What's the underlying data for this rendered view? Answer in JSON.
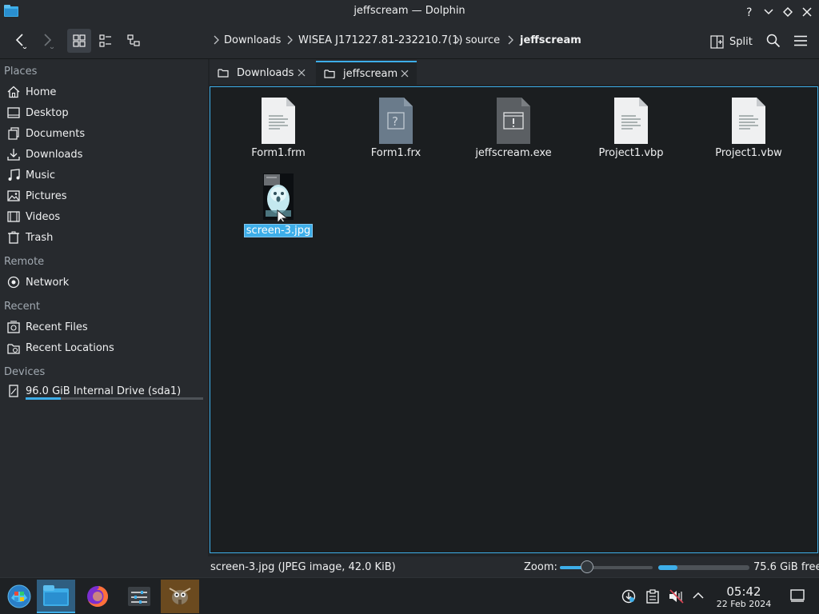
{
  "window": {
    "title": "jeffscream — Dolphin"
  },
  "toolbar": {
    "breadcrumb": [
      "Downloads",
      "WISEA J171227.81-232210.7(1)",
      "source",
      "jeffscream"
    ],
    "split_label": "Split"
  },
  "sidebar": {
    "sections": {
      "places": "Places",
      "remote": "Remote",
      "recent": "Recent",
      "devices": "Devices"
    },
    "places": [
      {
        "label": "Home",
        "icon": "home-icon"
      },
      {
        "label": "Desktop",
        "icon": "desktop-icon"
      },
      {
        "label": "Documents",
        "icon": "documents-icon"
      },
      {
        "label": "Downloads",
        "icon": "downloads-icon"
      },
      {
        "label": "Music",
        "icon": "music-icon"
      },
      {
        "label": "Pictures",
        "icon": "pictures-icon"
      },
      {
        "label": "Videos",
        "icon": "videos-icon"
      },
      {
        "label": "Trash",
        "icon": "trash-icon"
      }
    ],
    "remote": [
      {
        "label": "Network",
        "icon": "network-icon"
      }
    ],
    "recent": [
      {
        "label": "Recent Files",
        "icon": "recent-files-icon"
      },
      {
        "label": "Recent Locations",
        "icon": "recent-locations-icon"
      }
    ],
    "devices": [
      {
        "label": "96.0 GiB Internal Drive (sda1)",
        "icon": "drive-icon",
        "used_fraction": 0.2
      }
    ]
  },
  "tabs": [
    {
      "label": "Downloads",
      "active": false
    },
    {
      "label": "jeffscream",
      "active": true
    }
  ],
  "files": [
    {
      "name": "Form1.frm",
      "type": "text"
    },
    {
      "name": "Form1.frx",
      "type": "unknown"
    },
    {
      "name": "jeffscream.exe",
      "type": "executable"
    },
    {
      "name": "Project1.vbp",
      "type": "text"
    },
    {
      "name": "Project1.vbw",
      "type": "text"
    },
    {
      "name": "screen-3.jpg",
      "type": "image",
      "selected": true
    }
  ],
  "statusbar": {
    "info": "screen-3.jpg (JPEG image, 42.0 KiB)",
    "zoom_label": "Zoom:",
    "zoom_fraction": 0.29,
    "free_fraction": 0.21,
    "free_label": "75.6 GiB free"
  },
  "taskbar": {
    "time": "05:42",
    "date": "22 Feb 2024"
  },
  "colors": {
    "accent": "#3daee9",
    "window_bg": "#202326",
    "panel_bg": "#272a2e"
  }
}
